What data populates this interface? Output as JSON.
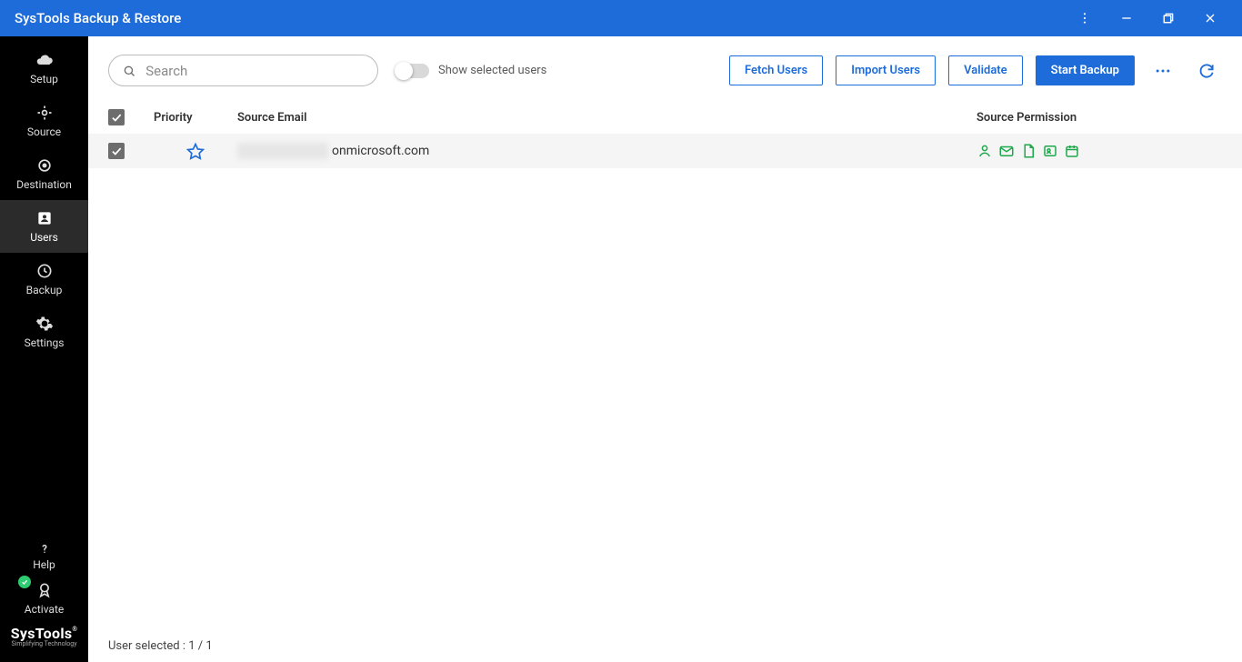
{
  "window": {
    "title": "SysTools Backup & Restore"
  },
  "sidebar": {
    "items": [
      {
        "label": "Setup"
      },
      {
        "label": "Source"
      },
      {
        "label": "Destination"
      },
      {
        "label": "Users"
      },
      {
        "label": "Backup"
      },
      {
        "label": "Settings"
      }
    ],
    "help_label": "Help",
    "activate_label": "Activate",
    "brand": "SysTools",
    "brand_tagline": "Simplifying Technology"
  },
  "toolbar": {
    "search_placeholder": "Search",
    "toggle_label": "Show selected users",
    "fetch_users": "Fetch Users",
    "import_users": "Import Users",
    "validate": "Validate",
    "start_backup": "Start Backup"
  },
  "table": {
    "headers": {
      "priority": "Priority",
      "source_email": "Source Email",
      "source_permission": "Source Permission"
    },
    "rows": [
      {
        "email_suffix": "onmicrosoft.com"
      }
    ]
  },
  "status": {
    "user_selected": "User selected : 1 / 1"
  }
}
